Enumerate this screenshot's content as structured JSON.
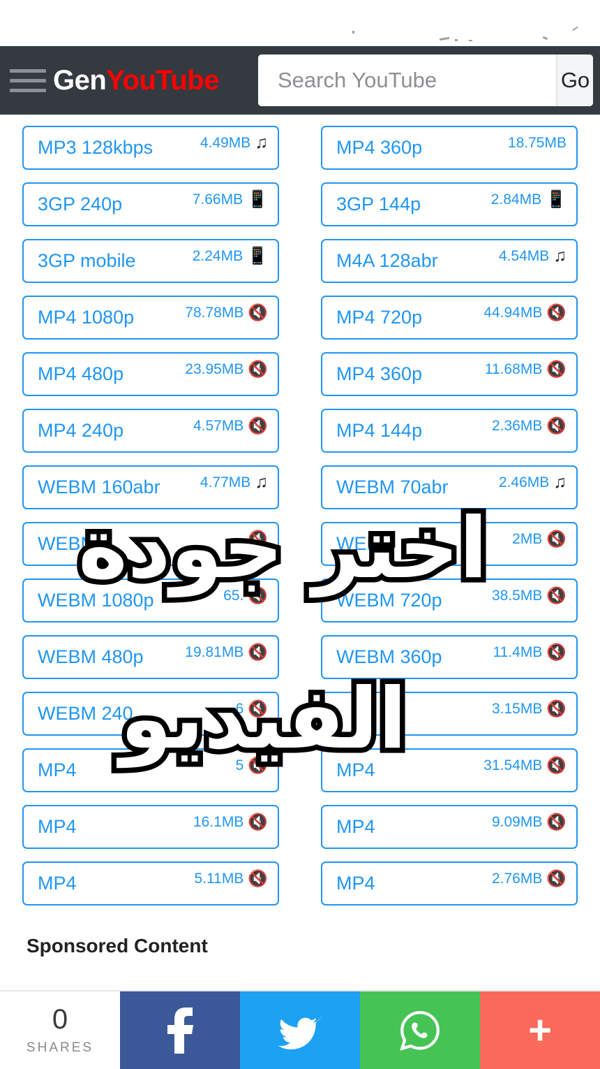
{
  "header": {
    "menu_icon": "hamburger-icon",
    "brand_part1": "Gen",
    "brand_part2": "YouTube",
    "search_value": "",
    "search_placeholder": "Search YouTube",
    "go_label": "Go"
  },
  "downloads": [
    {
      "label": "MP3 128kbps",
      "size": "4.49MB",
      "icon": "music-note-icon"
    },
    {
      "label": "MP4 360p",
      "size": "18.75MB",
      "icon": "none"
    },
    {
      "label": "3GP 240p",
      "size": "7.66MB",
      "icon": "mobile-phone-icon"
    },
    {
      "label": "3GP 144p",
      "size": "2.84MB",
      "icon": "mobile-phone-icon"
    },
    {
      "label": "3GP mobile",
      "size": "2.24MB",
      "icon": "mobile-phone-icon"
    },
    {
      "label": "M4A 128abr",
      "size": "4.54MB",
      "icon": "music-note-icon"
    },
    {
      "label": "MP4 1080p",
      "size": "78.78MB",
      "icon": "muted-speaker-icon"
    },
    {
      "label": "MP4 720p",
      "size": "44.94MB",
      "icon": "muted-speaker-icon"
    },
    {
      "label": "MP4 480p",
      "size": "23.95MB",
      "icon": "muted-speaker-icon"
    },
    {
      "label": "MP4 360p",
      "size": "11.68MB",
      "icon": "muted-speaker-icon"
    },
    {
      "label": "MP4 240p",
      "size": "4.57MB",
      "icon": "muted-speaker-icon"
    },
    {
      "label": "MP4 144p",
      "size": "2.36MB",
      "icon": "muted-speaker-icon"
    },
    {
      "label": "WEBM 160abr",
      "size": "4.77MB",
      "icon": "music-note-icon"
    },
    {
      "label": "WEBM 70abr",
      "size": "2.46MB",
      "icon": "music-note-icon"
    },
    {
      "label": "WEBM",
      "size": "",
      "icon": "muted-speaker-icon"
    },
    {
      "label": "WEBM",
      "size": "2MB",
      "icon": "muted-speaker-icon"
    },
    {
      "label": "WEBM 1080p",
      "size": "65.",
      "icon": "muted-speaker-icon"
    },
    {
      "label": "WEBM 720p",
      "size": "38.5MB",
      "icon": "muted-speaker-icon"
    },
    {
      "label": "WEBM 480p",
      "size": "19.81MB",
      "icon": "muted-speaker-icon"
    },
    {
      "label": "WEBM 360p",
      "size": "11.4MB",
      "icon": "muted-speaker-icon"
    },
    {
      "label": "WEBM 240",
      "size": "6",
      "icon": "muted-speaker-icon"
    },
    {
      "label": "",
      "size": "3.15MB",
      "icon": "muted-speaker-icon"
    },
    {
      "label": "MP4",
      "size": "5",
      "icon": "muted-speaker-icon"
    },
    {
      "label": "MP4",
      "size": "31.54MB",
      "icon": "muted-speaker-icon"
    },
    {
      "label": "MP4",
      "size": "16.1MB",
      "icon": "muted-speaker-icon"
    },
    {
      "label": "MP4",
      "size": "9.09MB",
      "icon": "muted-speaker-icon"
    },
    {
      "label": "MP4",
      "size": "5.11MB",
      "icon": "muted-speaker-icon"
    },
    {
      "label": "MP4",
      "size": "2.76MB",
      "icon": "muted-speaker-icon"
    }
  ],
  "sponsored_heading": "Sponsored Content",
  "share_bar": {
    "count": "0",
    "count_label": "SHARES",
    "buttons": [
      {
        "name": "facebook",
        "icon": "facebook-icon",
        "color": "#3b5998"
      },
      {
        "name": "twitter",
        "icon": "twitter-icon",
        "color": "#1da1f2"
      },
      {
        "name": "whatsapp",
        "icon": "whatsapp-icon",
        "color": "#45c455"
      },
      {
        "name": "more",
        "icon": "plus-icon",
        "color": "#f96a5c"
      }
    ]
  },
  "overlay_text": {
    "line1": "اختر جودة",
    "line2": "الفيديو"
  },
  "colors": {
    "header_bg": "#343a40",
    "brand_red": "#ff0000",
    "accent_blue": "#2196f3",
    "go_bg": "#f4f5f6"
  }
}
